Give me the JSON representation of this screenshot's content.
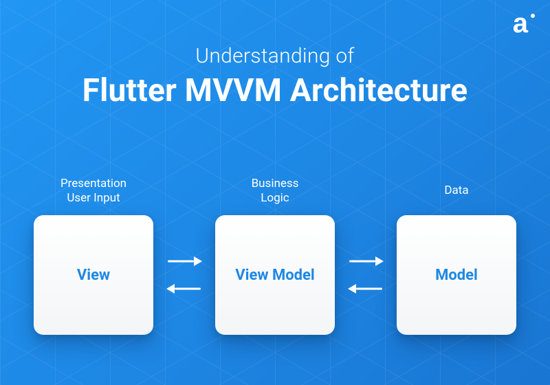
{
  "heading": {
    "subtitle": "Understanding of",
    "title": "Flutter MVVM Architecture"
  },
  "columns": [
    {
      "label": "Presentation\nUser Input",
      "card": "View"
    },
    {
      "label": "Business\nLogic",
      "card": "View Model"
    },
    {
      "label": "Data",
      "card": "Model"
    }
  ],
  "connections": [
    {
      "from": "View",
      "to": "View Model",
      "bidirectional": true
    },
    {
      "from": "View Model",
      "to": "Model",
      "bidirectional": true
    }
  ],
  "brand": {
    "glyph": "a"
  },
  "colors": {
    "bg_primary": "#1e88e5",
    "card_bg": "#ffffff",
    "card_text": "#1e88e5",
    "text": "#ffffff"
  }
}
